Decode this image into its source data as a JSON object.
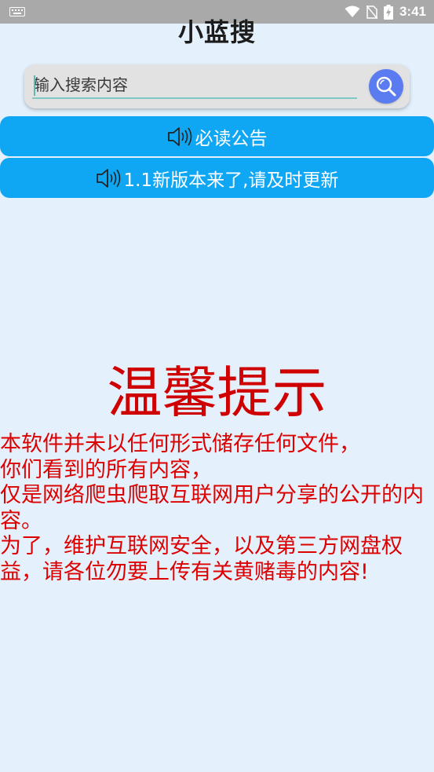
{
  "status_bar": {
    "time": "3:41",
    "icons": [
      "keyboard-icon",
      "wifi-icon",
      "no-sim-icon",
      "battery-charging-icon"
    ]
  },
  "app": {
    "title": "小蓝搜"
  },
  "search": {
    "placeholder": "输入搜索内容",
    "button_icon": "search-icon"
  },
  "notices": [
    {
      "label": "必读公告",
      "icon": "speaker-icon"
    },
    {
      "label": "1.1新版本来了,请及时更新",
      "icon": "speaker-icon"
    }
  ],
  "tip": {
    "title": "温馨提示",
    "lines": [
      "本软件并未以任何形式储存任何文件，",
      "你们看到的所有内容，",
      "仅是网络爬虫爬取互联网用户分享的公开的内容。",
      "为了，维护互联网安全，以及第三方网盘权益，请各位勿要上传有关黄赌毒的内容!"
    ]
  },
  "colors": {
    "background": "#e4f1fc",
    "accent": "#0fa7f4",
    "search_button": "#5b7cf0",
    "tip_red": "#dd0000"
  }
}
